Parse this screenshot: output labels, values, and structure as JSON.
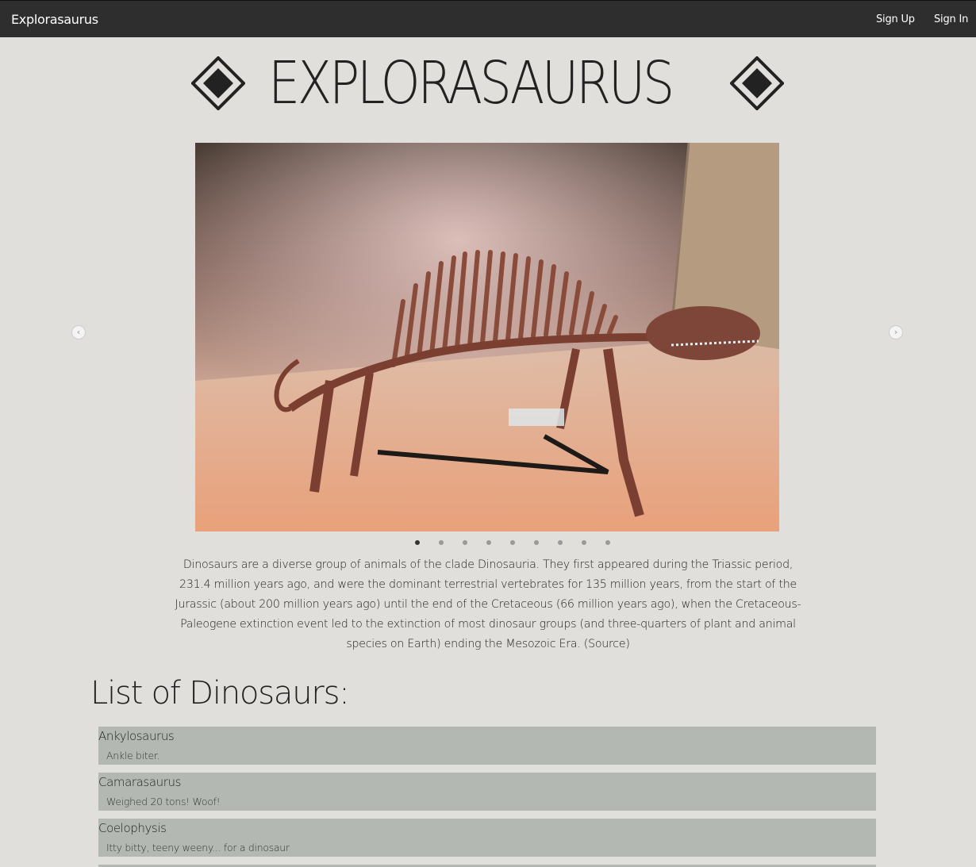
{
  "navbar": {
    "brand": "Explorasaurus",
    "sign_up": "Sign Up",
    "sign_in": "Sign In"
  },
  "header": {
    "title": "EXPLORASAURUS",
    "left_icon": "diamond-icon",
    "right_icon": "diamond-icon"
  },
  "carousel": {
    "active_slide": 1,
    "slide_count": 9,
    "image_subject": "dimetrodon-skeleton",
    "prev_icon": "chevron-left-icon",
    "next_icon": "chevron-right-icon"
  },
  "intro": {
    "text": "Dinosaurs are a diverse group of animals of the clade Dinosauria. They first appeared during the Triassic period, 231.4 million years ago, and were the dominant terrestrial vertebrates for 135 million years, from the start of the Jurassic (about 200 million years ago) until the end of the Cretaceous (66 million years ago), when the Cretaceous-Paleogene extinction event led to the extinction of most dinosaur groups (and three-quarters of plant and animal species on Earth) ending the Mesozoic Era. (Source)"
  },
  "list": {
    "title": "List of Dinosaurs:",
    "items": [
      {
        "name": "Ankylosaurus",
        "description": "Ankle biter."
      },
      {
        "name": "Camarasaurus",
        "description": "Weighed 20 tons! Woof!"
      },
      {
        "name": "Coelophysis",
        "description": "Itty bitty, teeny weeny... for a dinosaur"
      }
    ]
  },
  "colors": {
    "navbar_bg": "#2e2e2e",
    "page_bg": "#e0dfdb",
    "list_item_bg": "#b3b9b2"
  }
}
